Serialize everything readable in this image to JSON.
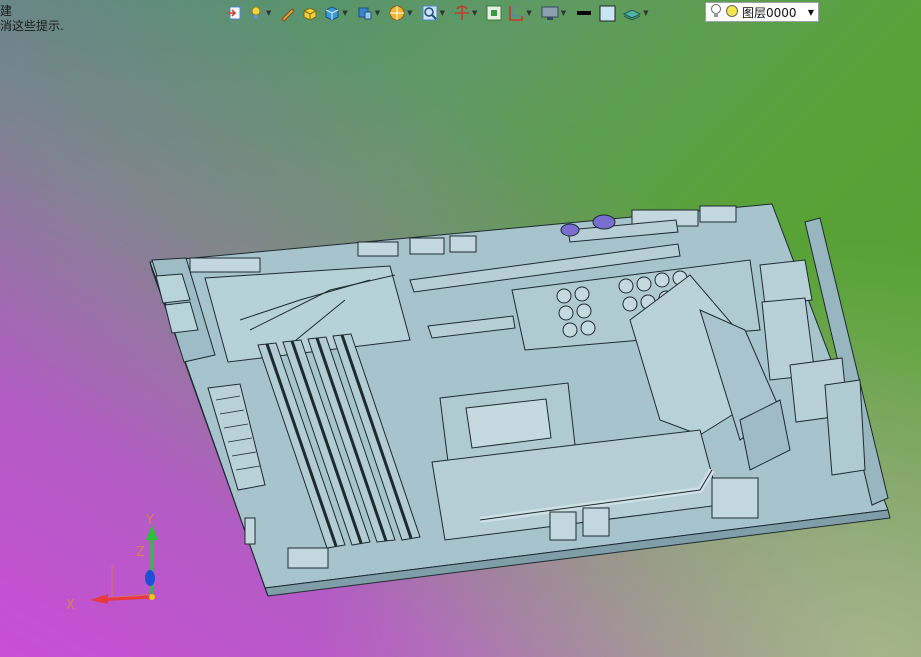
{
  "hint": {
    "line1": "建",
    "line2": "消这些提示."
  },
  "toolbar": {
    "items": [
      {
        "icon": "import-icon"
      },
      {
        "icon": "light-icon",
        "has_dropdown": true
      },
      {
        "icon": "pencil-icon"
      },
      {
        "icon": "box-yellow-icon"
      },
      {
        "icon": "cube-icon",
        "has_dropdown": true
      },
      {
        "icon": "view-cube-icon",
        "has_dropdown": true
      },
      {
        "icon": "render-style-icon",
        "has_dropdown": true
      },
      {
        "icon": "zoom-icon",
        "has_dropdown": true
      },
      {
        "icon": "rotate-icon",
        "has_dropdown": true
      },
      {
        "icon": "fit-view-icon"
      },
      {
        "icon": "section-icon",
        "has_dropdown": true
      },
      {
        "icon": "monitor-icon",
        "has_dropdown": true
      },
      {
        "icon": "line-color-icon"
      },
      {
        "icon": "fill-color-icon"
      },
      {
        "icon": "layer-plane-icon",
        "has_dropdown": true
      }
    ],
    "layer_select": {
      "value": "图层0000"
    }
  },
  "axes": {
    "x": "X",
    "y": "Y",
    "z": "Z"
  },
  "colors": {
    "model_fill": "#a9c6cf",
    "model_stroke": "#1d2a30",
    "accent_yellow": "#f0c419"
  }
}
